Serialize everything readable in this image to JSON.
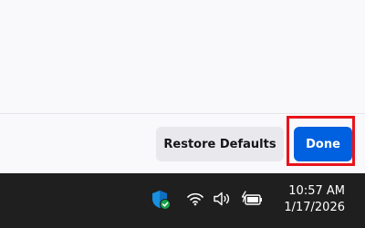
{
  "dialog": {
    "restore_defaults_label": "Restore Defaults",
    "done_label": "Done",
    "highlight_color": "#e8141b",
    "primary_color": "#0061e0"
  },
  "taskbar": {
    "tray_icons": [
      "security-shield-icon",
      "wifi-icon",
      "volume-icon",
      "battery-charging-icon"
    ],
    "time": "10:57 AM",
    "date": "1/17/2026"
  }
}
